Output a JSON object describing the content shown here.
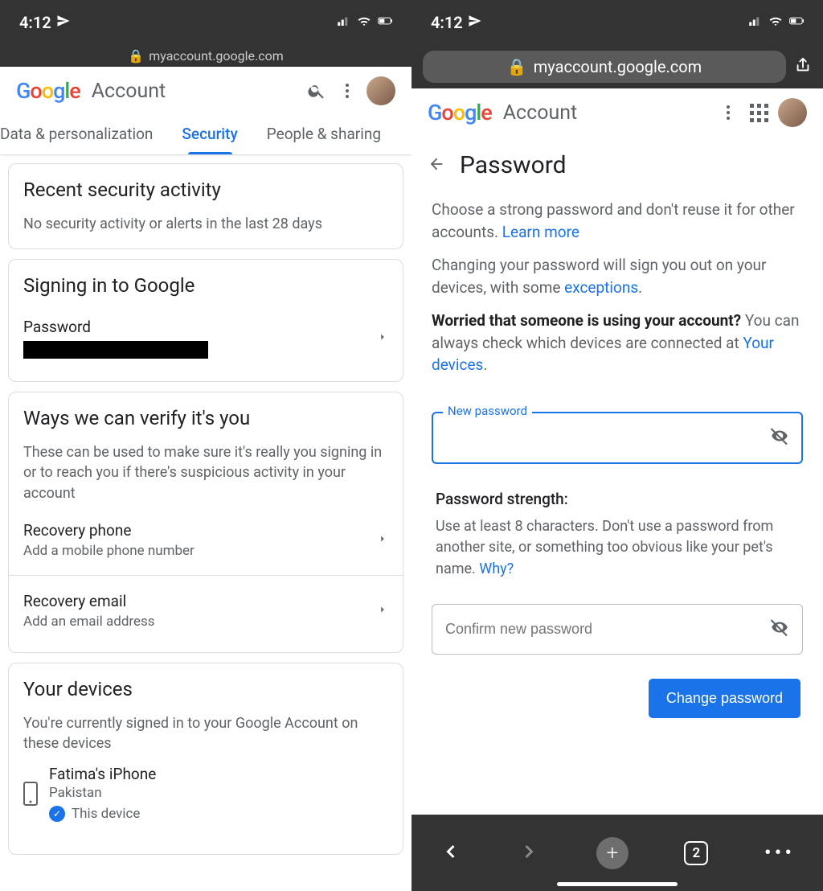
{
  "time": "4:12",
  "url": "myaccount.google.com",
  "brand": "Account",
  "left": {
    "tabs": {
      "data": "Data & personalization",
      "security": "Security",
      "people": "People & sharing"
    },
    "recent": {
      "title": "Recent security activity",
      "sub": "No security activity or alerts in the last 28 days"
    },
    "signin": {
      "title": "Signing in to Google",
      "password_label": "Password"
    },
    "verify": {
      "title": "Ways we can verify it's you",
      "sub": "These can be used to make sure it's really you signing in or to reach you if there's suspicious activity in your account",
      "phone_title": "Recovery phone",
      "phone_desc": "Add a mobile phone number",
      "email_title": "Recovery email",
      "email_desc": "Add an email address"
    },
    "devices": {
      "title": "Your devices",
      "sub": "You're currently signed in to your Google Account on these devices",
      "device_name": "Fatima's iPhone",
      "device_loc": "Pakistan",
      "this_device": "This device"
    }
  },
  "right": {
    "title": "Password",
    "p1a": "Choose a strong password and don't reuse it for other accounts. ",
    "learn_more": "Learn more",
    "p2a": "Changing your password will sign you out on your devices, with some ",
    "exceptions": "exceptions",
    "p3a": "Worried that someone is using your account? ",
    "p3b": "You can always check which devices are connected at ",
    "your_devices": "Your devices",
    "new_password_label": "New password",
    "strength_title": "Password strength:",
    "strength_body": "Use at least 8 characters. Don't use a password from another site, or something too obvious like your pet's name. ",
    "why": "Why?",
    "confirm_placeholder": "Confirm new password",
    "change_btn": "Change password",
    "tab_count": "2"
  }
}
